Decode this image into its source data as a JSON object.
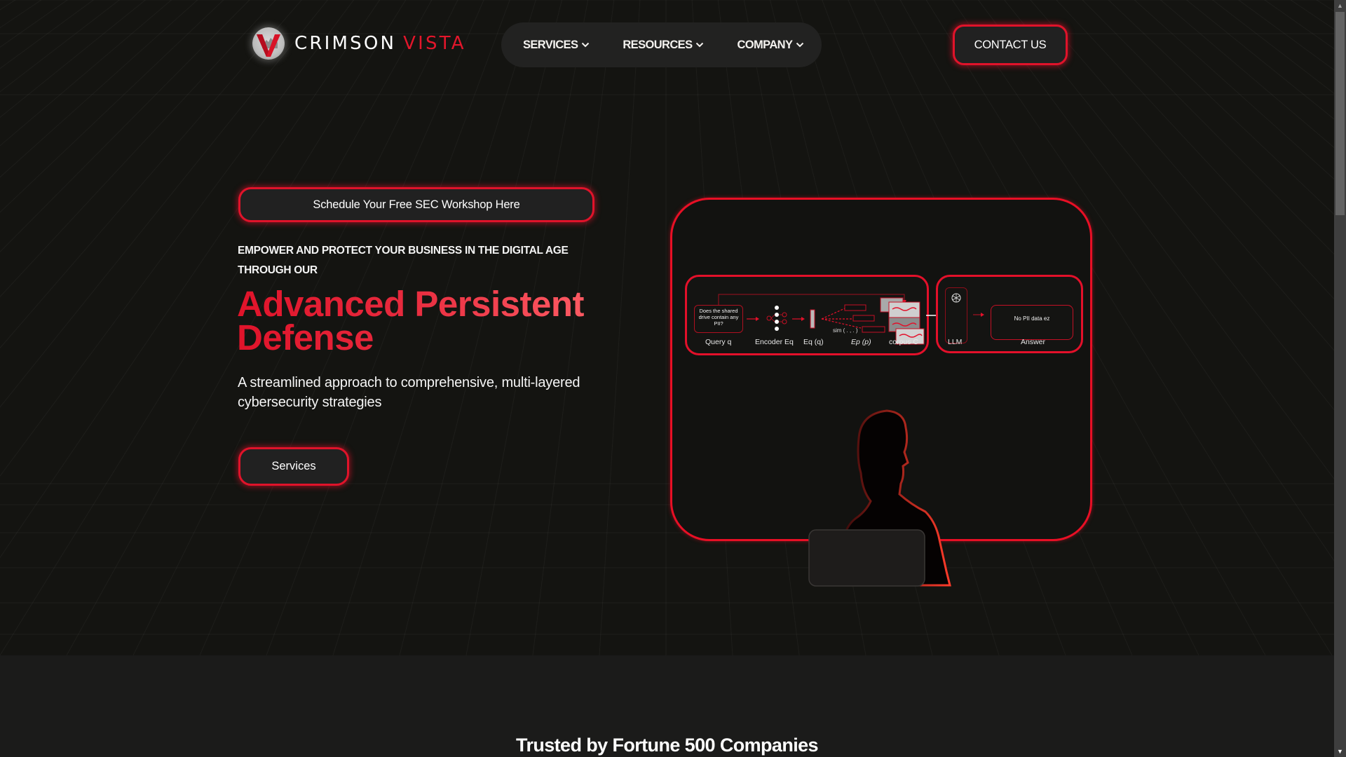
{
  "brand": {
    "name_primary": "CRIMSON",
    "name_accent": "VISTA",
    "logo_icon": "v-mountain-logo-icon",
    "accent_color": "#e0132a"
  },
  "nav": {
    "items": [
      {
        "label": "SERVICES",
        "icon": "chevron-down-icon"
      },
      {
        "label": "RESOURCES",
        "icon": "chevron-down-icon"
      },
      {
        "label": "COMPANY",
        "icon": "chevron-down-icon"
      }
    ],
    "contact_label": "CONTACT US"
  },
  "hero": {
    "workshop_cta": "Schedule Your Free SEC Workshop Here",
    "eyebrow": "EMPOWER AND PROTECT YOUR BUSINESS IN THE DIGITAL AGE THROUGH OUR",
    "headline": "Advanced Persistent Defense",
    "subtext": "A streamlined approach to comprehensive, multi-layered cybersecurity strategies",
    "services_button": "Services"
  },
  "diagram": {
    "query_text": "Does the shared drive contain any PII?",
    "labels": {
      "query": "Query q",
      "encoder": "Encoder Eq",
      "eq": "Eq (q)",
      "ep": "Ep (p)",
      "corpus": "corpus C",
      "sim": "sim ( . , . )",
      "llm": "LLM",
      "answer": "Answer"
    },
    "answer_text": "No PII data ez",
    "llm_icon": "openai-logo-icon",
    "person_icon": "person-silhouette-icon"
  },
  "trusted": {
    "title": "Trusted by Fortune 500 Companies"
  },
  "scrollbar": {
    "up_icon": "scroll-up-arrow-icon",
    "down_icon": "scroll-down-arrow-icon",
    "position_fraction": 0.0
  }
}
